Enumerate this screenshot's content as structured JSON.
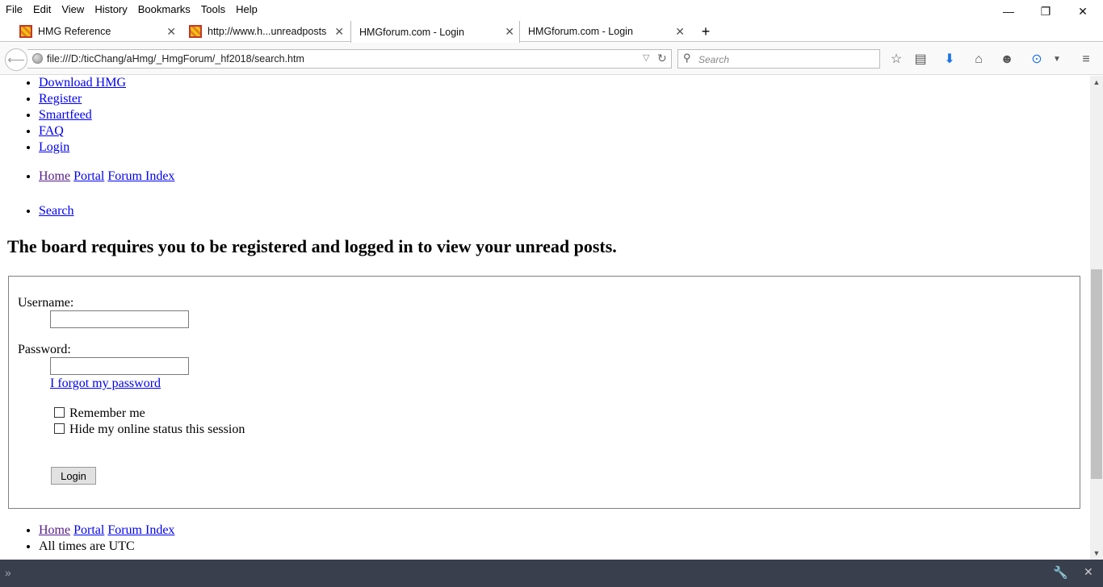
{
  "menu": [
    "File",
    "Edit",
    "View",
    "History",
    "Bookmarks",
    "Tools",
    "Help"
  ],
  "window_controls": {
    "minimize": "—",
    "restore": "❐",
    "close": "✕"
  },
  "tabs": [
    {
      "title": "HMG Reference",
      "has_favicon": true
    },
    {
      "title": "http://www.h...unreadposts",
      "has_favicon": true
    },
    {
      "title": "HMGforum.com - Login",
      "has_favicon": false,
      "selected": true
    },
    {
      "title": "HMGforum.com - Login",
      "has_favicon": false
    }
  ],
  "navbar": {
    "url": "file:///D:/ticChang/aHmg/_HmgForum/_hf2018/search.htm",
    "search_placeholder": "Search"
  },
  "page": {
    "top_links": [
      "Download HMG",
      "Register",
      "Smartfeed",
      "FAQ",
      "Login"
    ],
    "breadcrumb": {
      "home": "Home",
      "portal": "Portal",
      "forum_index": "Forum Index"
    },
    "search_link": "Search",
    "message": "The board requires you to be registered and logged in to view your unread posts.",
    "login_form": {
      "username_label": "Username:",
      "username_value": "",
      "password_label": "Password:",
      "password_value": "",
      "forgot_link": "I forgot my password",
      "remember_me": "Remember me",
      "hide_online": "Hide my online status this session",
      "login_button": "Login"
    },
    "footer": {
      "timezone_note": "All times are UTC"
    }
  },
  "colors": {
    "link": "#0000ee",
    "visited_link": "#551a8b",
    "devtools_bar": "#393f4c"
  }
}
